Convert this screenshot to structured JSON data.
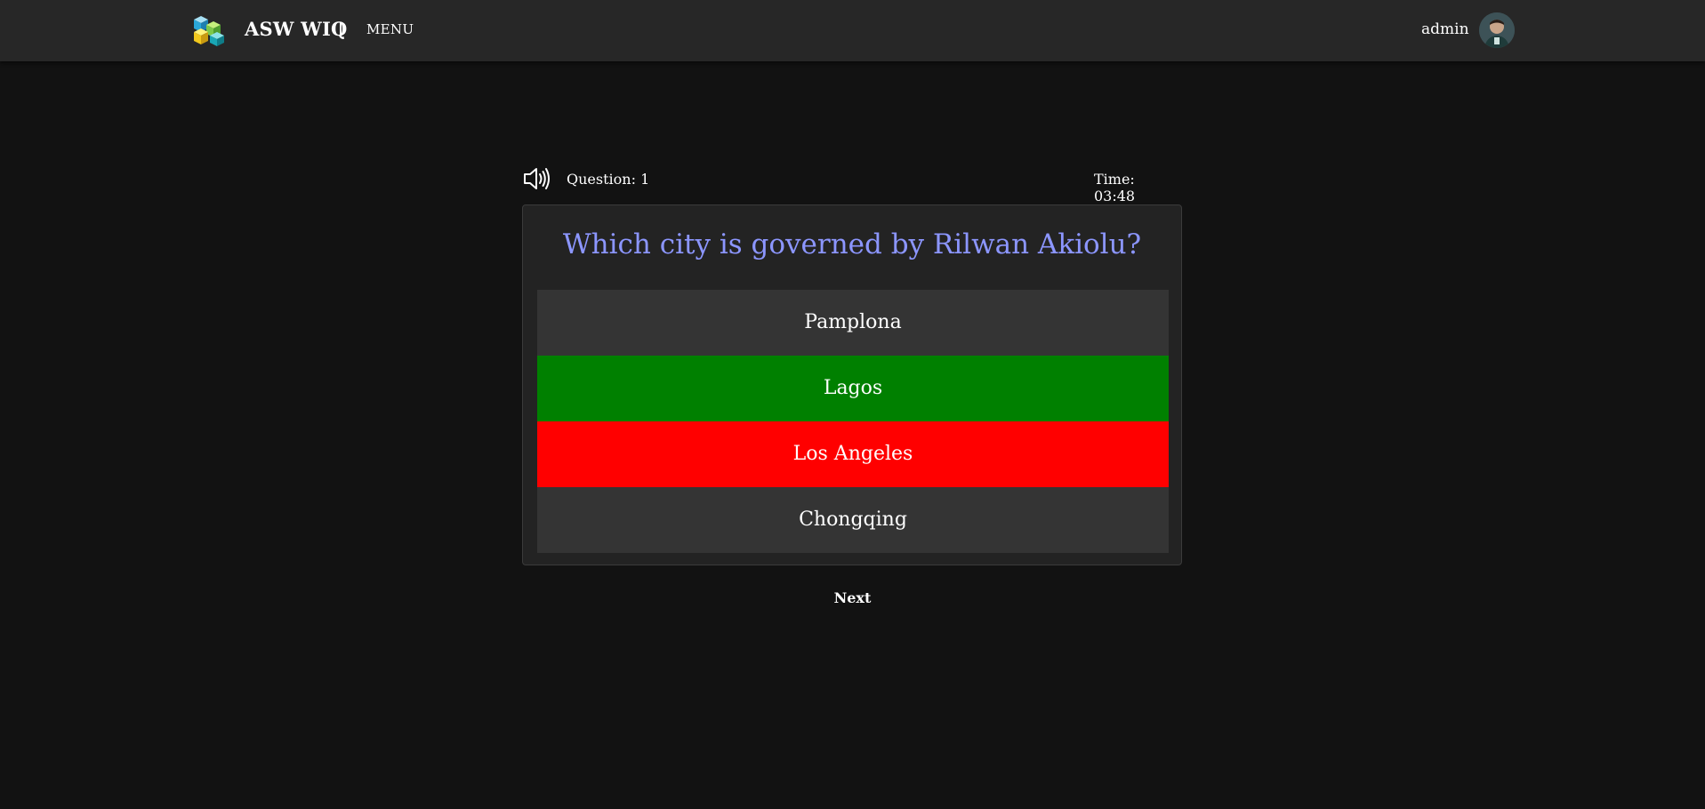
{
  "app": {
    "title": "ASW WIQ",
    "menu_label": "MENU",
    "username": "admin"
  },
  "quiz": {
    "question_label": "Question: 1",
    "timer_label": "Time: 03:48",
    "question": "Which city is governed by Rilwan Akiolu?",
    "answers": [
      {
        "label": "Pamplona",
        "color": "#343434"
      },
      {
        "label": "Lagos",
        "color": "#008000"
      },
      {
        "label": "Los Angeles",
        "color": "#ff0000"
      },
      {
        "label": "Chongqing",
        "color": "#343434"
      }
    ],
    "next_label": "Next"
  },
  "colors": {
    "background": "#121212",
    "appbar": "#272727",
    "question_text": "#8c96ff",
    "correct": "#008000",
    "incorrect": "#ff0000",
    "neutral": "#343434"
  }
}
